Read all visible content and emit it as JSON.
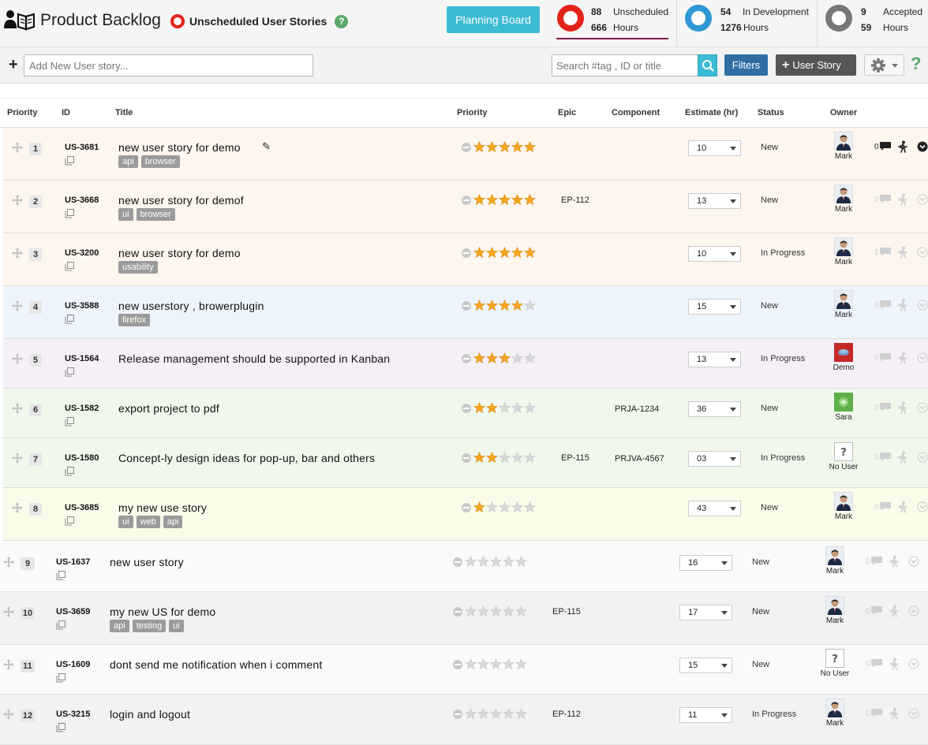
{
  "header": {
    "title": "Product Backlog",
    "view_label": "Unscheduled User Stories",
    "help": "?",
    "planning_board": "Planning Board",
    "stats": [
      {
        "count": "88",
        "label": "Unscheduled",
        "hours": "666",
        "hours_label": "Hours",
        "color": "#e2231a"
      },
      {
        "count": "54",
        "label": "In Development",
        "hours": "1276",
        "hours_label": "Hours",
        "color": "#2f97d5"
      },
      {
        "count": "9",
        "label": "Accepted",
        "hours": "59",
        "hours_label": "Hours",
        "color": "#777777"
      }
    ],
    "accent_underline": "#7a1a4a"
  },
  "toolbar": {
    "new_story_placeholder": "Add New User story...",
    "search_placeholder": "Search #tag , ID or title",
    "filters": "Filters",
    "user_story": "User Story",
    "help": "?"
  },
  "columns": {
    "priority_num": "Priority",
    "id": "ID",
    "title": "Title",
    "priority": "Priority",
    "epic": "Epic",
    "component": "Component",
    "estimate": "Estimate (hr)",
    "status": "Status",
    "owner": "Owner"
  },
  "rows": [
    {
      "n": "1",
      "id": "US-3681",
      "title": "new user story for demo",
      "tags": [
        "api",
        "browser"
      ],
      "stars": 5,
      "epic": "",
      "component": "",
      "estimate": "10",
      "status": "New",
      "owner": "Mark",
      "owner_type": "mark",
      "comments": "0",
      "bg": "#fdf6ee"
    },
    {
      "n": "2",
      "id": "US-3668",
      "title": "new user story for demof",
      "tags": [
        "ui",
        "browser"
      ],
      "stars": 5,
      "epic": "EP-112",
      "component": "",
      "estimate": "13",
      "status": "New",
      "owner": "Mark",
      "owner_type": "mark",
      "comments": "0",
      "bg": "#fdf6ee"
    },
    {
      "n": "3",
      "id": "US-3200",
      "title": "new user story for demo",
      "tags": [
        "usability"
      ],
      "stars": 5,
      "epic": "",
      "component": "",
      "estimate": "10",
      "status": "In Progress",
      "owner": "Mark",
      "owner_type": "mark",
      "comments": "1",
      "bg": "#fdf6ee"
    },
    {
      "n": "4",
      "id": "US-3588",
      "title": "new userstory , browerplugin",
      "tags": [
        "firefox"
      ],
      "stars": 4,
      "epic": "",
      "component": "",
      "estimate": "15",
      "status": "New",
      "owner": "Mark",
      "owner_type": "mark",
      "comments": "0",
      "bg": "#eef4fb"
    },
    {
      "n": "5",
      "id": "US-1564",
      "title": "Release management should be supported in Kanban",
      "tags": [],
      "stars": 3,
      "epic": "",
      "component": "",
      "estimate": "13",
      "status": "In Progress",
      "owner": "Demo",
      "owner_type": "demo",
      "comments": "0",
      "bg": "#f5f0f8"
    },
    {
      "n": "6",
      "id": "US-1582",
      "title": "export project to pdf",
      "tags": [],
      "stars": 2,
      "epic": "",
      "component": "PRJA-1234",
      "estimate": "36",
      "status": "New",
      "owner": "Sara",
      "owner_type": "sara",
      "comments": "0",
      "bg": "#f0f8ec"
    },
    {
      "n": "7",
      "id": "US-1580",
      "title": "Concept-ly design ideas for pop-up, bar and others",
      "tags": [],
      "stars": 2,
      "epic": "EP-115",
      "component": "PRJVA-4567",
      "estimate": "03",
      "status": "In Progress",
      "owner": "No User",
      "owner_type": "none",
      "comments": "0",
      "bg": "#f0f8ec"
    },
    {
      "n": "8",
      "id": "US-3685",
      "title": "my new use story",
      "tags": [
        "ui",
        "web",
        "api"
      ],
      "stars": 1,
      "epic": "",
      "component": "",
      "estimate": "43",
      "status": "New",
      "owner": "Mark",
      "owner_type": "mark",
      "comments": "0",
      "bg": "#fafbe9"
    },
    {
      "n": "9",
      "id": "US-1637",
      "title": "new user story",
      "tags": [],
      "stars": 0,
      "epic": "",
      "component": "",
      "estimate": "16",
      "status": "New",
      "owner": "Mark",
      "owner_type": "mark",
      "comments": "0",
      "bg": "#fafafa"
    },
    {
      "n": "10",
      "id": "US-3659",
      "title": "my new US for demo",
      "tags": [
        "api",
        "testing",
        "ui"
      ],
      "stars": 0,
      "epic": "EP-115",
      "component": "",
      "estimate": "17",
      "status": "New",
      "owner": "Mark",
      "owner_type": "mark",
      "comments": "0",
      "bg": "#f2f2f2"
    },
    {
      "n": "11",
      "id": "US-1609",
      "title": "dont send me notification when i comment",
      "tags": [],
      "stars": 0,
      "epic": "",
      "component": "",
      "estimate": "15",
      "status": "New",
      "owner": "No User",
      "owner_type": "none",
      "comments": "0",
      "bg": "#fafafa"
    },
    {
      "n": "12",
      "id": "US-3215",
      "title": "login and logout",
      "tags": [],
      "stars": 0,
      "epic": "EP-112",
      "component": "",
      "estimate": "11",
      "status": "In Progress",
      "owner": "Mark",
      "owner_type": "mark",
      "comments": "0",
      "bg": "#f2f2f2"
    }
  ]
}
